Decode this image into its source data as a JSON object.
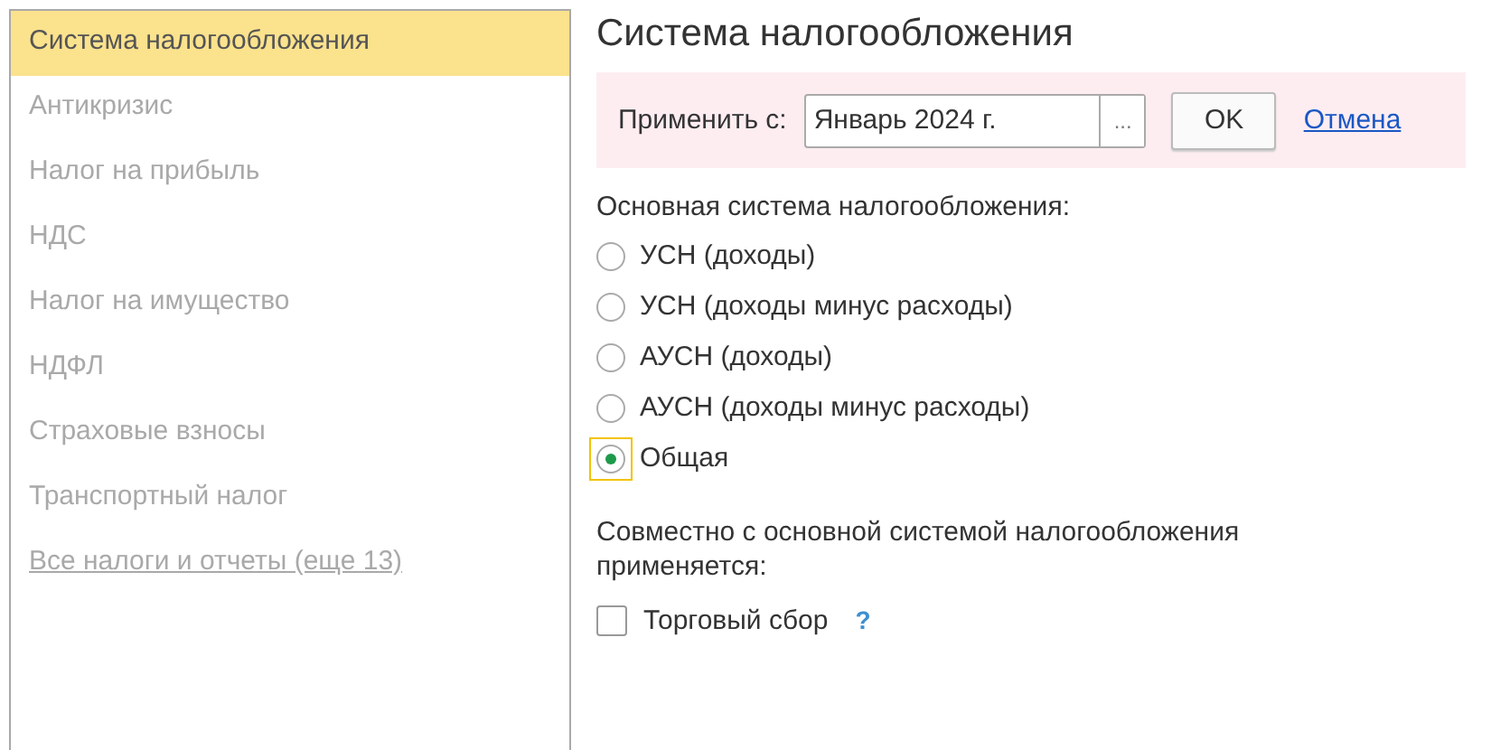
{
  "sidebar": {
    "items": [
      {
        "label": "Система налогообложения",
        "kind": "item",
        "selected": true
      },
      {
        "label": "Антикризис",
        "kind": "item",
        "selected": false
      },
      {
        "label": "Налог на прибыль",
        "kind": "item",
        "selected": false
      },
      {
        "label": "НДС",
        "kind": "item",
        "selected": false
      },
      {
        "label": "Налог на имущество",
        "kind": "item",
        "selected": false
      },
      {
        "label": "НДФЛ",
        "kind": "item",
        "selected": false
      },
      {
        "label": "Страховые взносы",
        "kind": "item",
        "selected": false
      },
      {
        "label": "Транспортный налог",
        "kind": "item",
        "selected": false
      },
      {
        "label": "Все налоги и отчеты (еще 13)",
        "kind": "link",
        "selected": false
      }
    ]
  },
  "title": "Система налогообложения",
  "apply_bar": {
    "label": "Применить с:",
    "date_value": "Январь 2024 г.",
    "picker_button": "...",
    "ok_button": "OK",
    "cancel_link": "Отмена"
  },
  "main_system": {
    "label": "Основная система налогообложения:",
    "options": [
      {
        "label": "УСН (доходы)",
        "selected": false,
        "focused": false
      },
      {
        "label": "УСН (доходы минус расходы)",
        "selected": false,
        "focused": false
      },
      {
        "label": "АУСН (доходы)",
        "selected": false,
        "focused": false
      },
      {
        "label": "АУСН (доходы минус расходы)",
        "selected": false,
        "focused": false
      },
      {
        "label": "Общая",
        "selected": true,
        "focused": true
      }
    ]
  },
  "additional": {
    "label": "Совместно с основной системой налогообложения применяется:",
    "options": [
      {
        "label": "Торговый сбор",
        "checked": false,
        "help": "?"
      }
    ]
  }
}
